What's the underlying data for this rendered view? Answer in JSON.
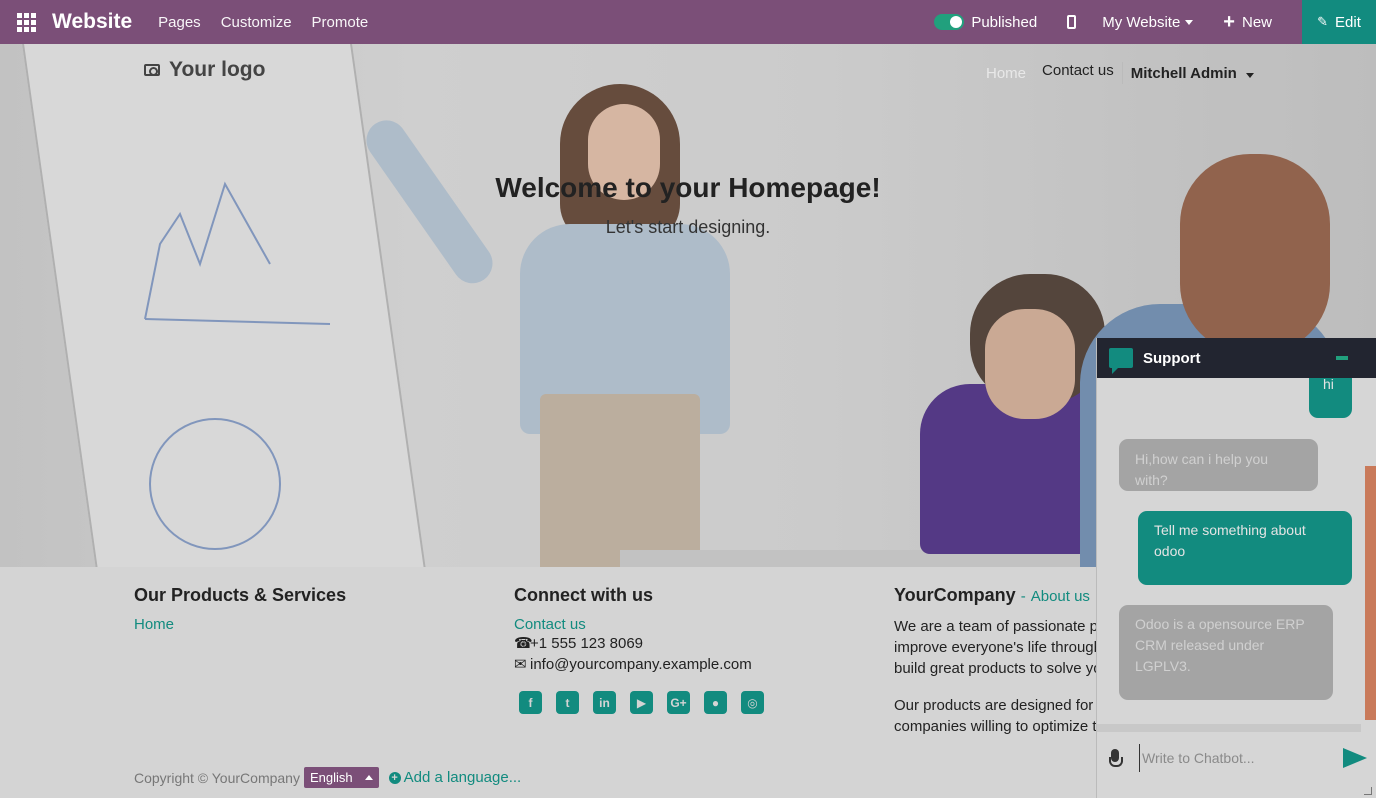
{
  "topbar": {
    "brand": "Website",
    "menus": [
      "Pages",
      "Customize",
      "Promote"
    ],
    "published_label": "Published",
    "my_website_label": "My Website",
    "new_label": "New",
    "edit_label": "Edit",
    "colors": {
      "bar": "#7b4f78",
      "edit": "#128b7f",
      "toggle": "#21a07d"
    }
  },
  "site_header": {
    "logo_text": "Your logo",
    "nav": {
      "home": "Home",
      "contact": "Contact us",
      "user": "Mitchell Admin"
    }
  },
  "hero": {
    "title": "Welcome to your Homepage!",
    "subtitle": "Let's start designing."
  },
  "footer": {
    "col1": {
      "title": "Our Products & Services",
      "link": "Home"
    },
    "col2": {
      "title": "Connect with us",
      "link": "Contact us",
      "phone": "+1 555 123 8069",
      "email": "info@yourcompany.example.com",
      "social": [
        "facebook-icon",
        "twitter-icon",
        "linkedin-icon",
        "youtube-icon",
        "google-plus-icon",
        "github-icon",
        "instagram-icon"
      ]
    },
    "col3": {
      "title": "YourCompany",
      "about_link": "About us",
      "para1_line1": "We are a team of passionate peo",
      "para1_line2": "improve everyone's life through d",
      "para1_line3": "build great products to solve you",
      "para2_line1": "Our products are designed for sn",
      "para2_line2": "companies willing to optimize the"
    },
    "copyright": "Copyright © YourCompany",
    "language": "English",
    "add_language": "Add a language..."
  },
  "chat": {
    "title": "Support",
    "messages": [
      {
        "from": "user",
        "text": "hi"
      },
      {
        "from": "bot",
        "text": "Hi,how can i help you with?"
      },
      {
        "from": "user",
        "text": "Tell me something about odoo"
      },
      {
        "from": "bot",
        "text": "Odoo is a opensource ERP CRM released under LGPLV3."
      }
    ],
    "input_placeholder": "Write to Chatbot..."
  }
}
